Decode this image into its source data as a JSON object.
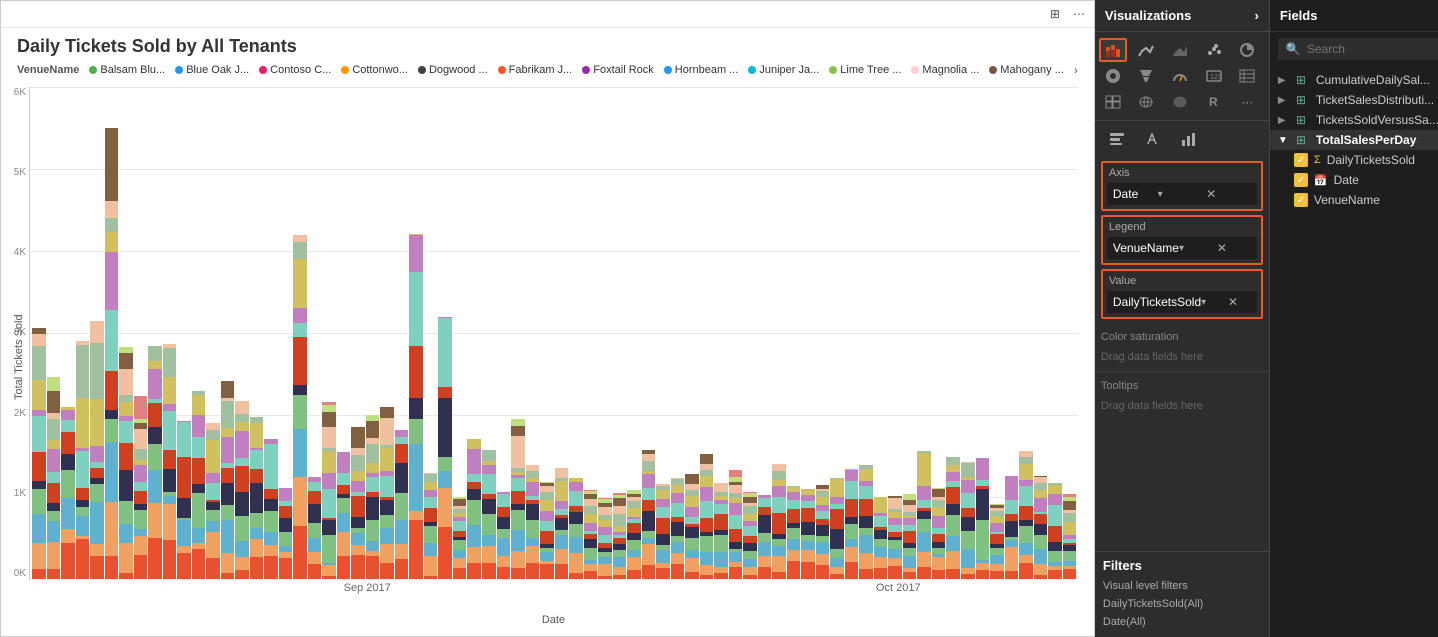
{
  "chart": {
    "title": "Daily Tickets Sold by All Tenants",
    "y_axis_label": "Total Tickets Sold",
    "x_axis_label": "Date",
    "y_ticks": [
      "6K",
      "5K",
      "4K",
      "3K",
      "2K",
      "1K",
      "0K"
    ],
    "x_labels": [
      "Sep 2017",
      "Oct 2017"
    ],
    "legend_label": "VenueName",
    "legend_items": [
      {
        "label": "Balsam Blu...",
        "color": "#4CAF50"
      },
      {
        "label": "Blue Oak J...",
        "color": "#2196F3"
      },
      {
        "label": "Contoso C...",
        "color": "#E91E63"
      },
      {
        "label": "Cottonwo...",
        "color": "#FF9800"
      },
      {
        "label": "Dogwood ...",
        "color": "#424242"
      },
      {
        "label": "Fabrikam J...",
        "color": "#FF5722"
      },
      {
        "label": "Foxtail Rock",
        "color": "#9C27B0"
      },
      {
        "label": "Hornbeam ...",
        "color": "#2196F3"
      },
      {
        "label": "Juniper Ja...",
        "color": "#00BCD4"
      },
      {
        "label": "Lime Tree ...",
        "color": "#8BC34A"
      },
      {
        "label": "Magnolia ...",
        "color": "#FFCDD2"
      },
      {
        "label": "Mahogany ...",
        "color": "#795548"
      }
    ]
  },
  "toolbar": {
    "focus_icon": "⊞",
    "more_icon": "⋯"
  },
  "visualizations_panel": {
    "header": "Visualizations",
    "expand_icon": "›",
    "format_icons": [
      "🖊",
      "🔧",
      "🔔"
    ],
    "sections": {
      "axis": {
        "label": "Axis",
        "value": "Date"
      },
      "legend": {
        "label": "Legend",
        "value": "VenueName"
      },
      "value": {
        "label": "Value",
        "value": "DailyTicketsSold"
      },
      "color_saturation": "Color saturation",
      "color_drag": "Drag data fields here",
      "tooltips": "Tooltips",
      "tooltips_drag": "Drag data fields here"
    }
  },
  "filters": {
    "label": "Filters",
    "items": [
      "Visual level filters",
      "DailyTicketsSold(All)",
      "Date(All)"
    ]
  },
  "fields_panel": {
    "header": "Fields",
    "expand_icon": "›",
    "search_placeholder": "Search",
    "tables": [
      {
        "name": "CumulativeDailySal...",
        "active": false
      },
      {
        "name": "TicketSalesDistributi...",
        "active": false
      },
      {
        "name": "TicketsSoldVersusSa...",
        "active": false
      },
      {
        "name": "TotalSalesPerDay",
        "active": true,
        "fields": [
          {
            "name": "DailyTicketsSold",
            "type": "sigma",
            "checked": true
          },
          {
            "name": "Date",
            "type": "calendar",
            "checked": true
          },
          {
            "name": "VenueName",
            "type": "text",
            "checked": true
          }
        ]
      }
    ]
  },
  "bar_colors": [
    "#e06040",
    "#f0a060",
    "#60a0d0",
    "#80c080",
    "#303050",
    "#d04020",
    "#80d0c0",
    "#c080c0",
    "#d0c060",
    "#a0c0a0",
    "#f0c0a0",
    "#806040",
    "#c0e080",
    "#e08080",
    "#8080e0",
    "#60c0c0",
    "#e0a080",
    "#90905a"
  ]
}
